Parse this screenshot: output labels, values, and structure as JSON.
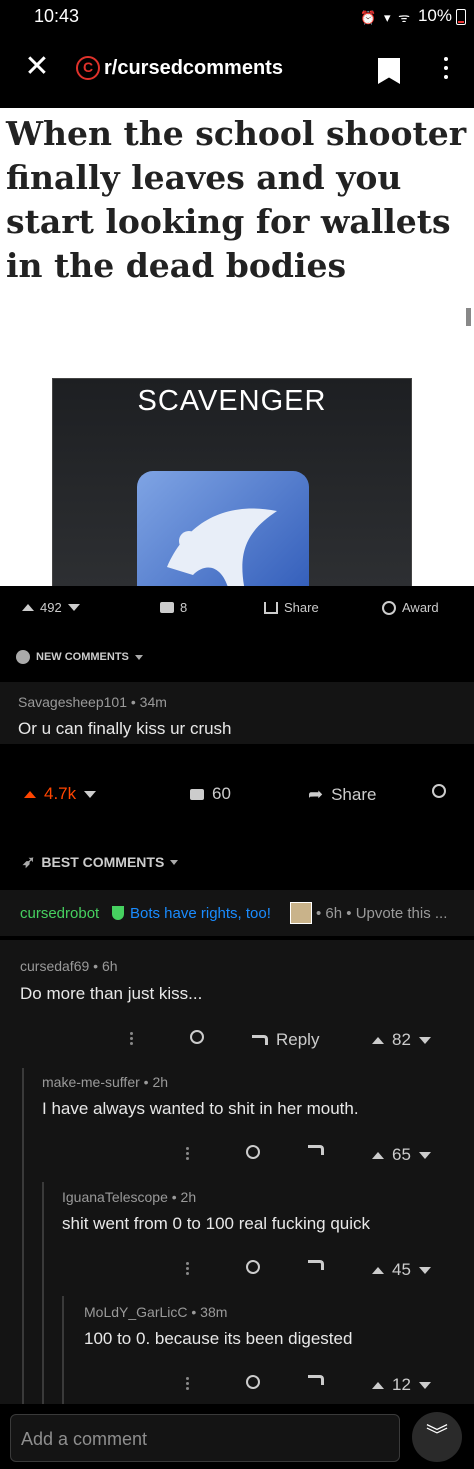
{
  "status_bar": {
    "time": "10:43",
    "battery": "10%"
  },
  "header": {
    "subreddit": "r/cursedcomments"
  },
  "post": {
    "meme_text": "When the school shooter finally leaves and you start looking for wallets in the dead bodies",
    "image_label": "SCAVENGER",
    "votes": "492",
    "comments": "8",
    "share_label": "Share",
    "award_label": "Award"
  },
  "new_comments": {
    "heading": "NEW COMMENTS",
    "author": "Savagesheep101 • 34m",
    "body": "Or u can finally kiss ur crush"
  },
  "parent_actions": {
    "votes": "4.7k",
    "comments": "60",
    "share_label": "Share"
  },
  "best_comments": {
    "heading": "BEST COMMENTS",
    "bot_name": "cursedrobot",
    "bot_flair": "Bots have rights, too!",
    "bot_meta": "• 6h • Upvote this ..."
  },
  "comments": [
    {
      "author": "cursedaf69 • 6h",
      "body": "Do more than just kiss...",
      "reply_label": "Reply",
      "votes": "82"
    },
    {
      "author": "make-me-suffer • 2h",
      "body": "I have always wanted to shit in her mouth.",
      "votes": "65"
    },
    {
      "author": "IguanaTelescope • 2h",
      "body": "shit went from 0 to 100 real fucking quick",
      "votes": "45"
    },
    {
      "author": "MoLdY_GarLicC • 38m",
      "body": "100 to 0. because its been digested",
      "votes": "12"
    }
  ],
  "bottom_bar": {
    "placeholder": "Add a comment"
  }
}
